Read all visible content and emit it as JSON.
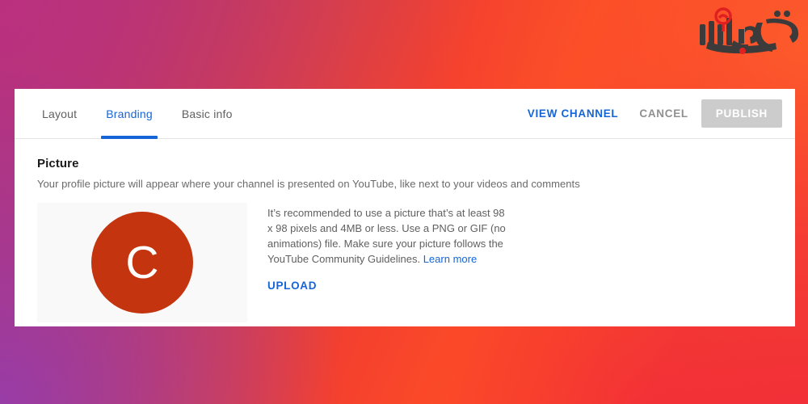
{
  "background": {
    "gradient_colors": [
      "#b0337a",
      "#963caa",
      "#f4402e",
      "#ef3039"
    ]
  },
  "watermark": {
    "name": "persian-site-logo",
    "script_color": "#3b3b3b",
    "accent_color": "#e02020"
  },
  "tabs": [
    {
      "id": "layout",
      "label": "Layout",
      "active": false
    },
    {
      "id": "branding",
      "label": "Branding",
      "active": true
    },
    {
      "id": "basic-info",
      "label": "Basic info",
      "active": false
    }
  ],
  "actions": {
    "view_channel": "VIEW CHANNEL",
    "cancel": "CANCEL",
    "publish": "PUBLISH",
    "link_color": "#1565d8",
    "publish_bg": "#cccccc"
  },
  "picture_section": {
    "title": "Picture",
    "description": "Your profile picture will appear where your channel is presented on YouTube, like next to your videos and comments",
    "avatar": {
      "initial": "C",
      "circle_color": "#c3340f",
      "text_color": "#ffffff",
      "box_color": "#f9f9f9"
    },
    "recommendation": "It’s recommended to use a picture that’s at least 98 x 98 pixels and 4MB or less. Use a PNG or GIF (no animations) file. Make sure your picture follows the YouTube Community Guidelines. ",
    "learn_more": "Learn more",
    "upload": "UPLOAD"
  }
}
